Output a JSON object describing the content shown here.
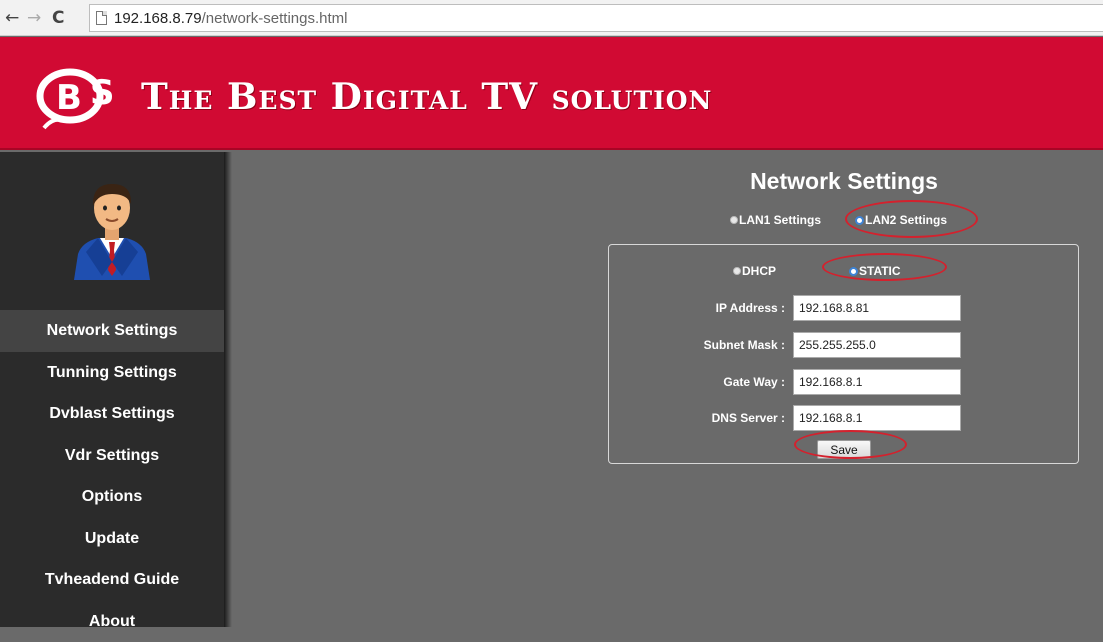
{
  "browser": {
    "back_icon": "back-arrow-icon",
    "forward_icon": "forward-arrow-icon",
    "reload_icon": "reload-icon",
    "url_host": "192.168.8.79",
    "url_path": "/network-settings.html"
  },
  "banner": {
    "title": "The Best Digital TV solution",
    "brand_color": "#d10a33"
  },
  "sidebar": {
    "items": [
      {
        "label": "Network Settings",
        "active": true
      },
      {
        "label": "Tunning Settings"
      },
      {
        "label": "Dvblast Settings"
      },
      {
        "label": "Vdr Settings"
      },
      {
        "label": "Options"
      },
      {
        "label": "Update"
      },
      {
        "label": "Tvheadend Guide"
      },
      {
        "label": "About"
      }
    ]
  },
  "main": {
    "title": "Network Settings",
    "lan_options": [
      {
        "label": "LAN1 Settings",
        "checked": false
      },
      {
        "label": "LAN2 Settings",
        "checked": true
      }
    ],
    "mode_options": [
      {
        "label": "DHCP",
        "checked": false
      },
      {
        "label": "STATIC",
        "checked": true
      }
    ],
    "fields": {
      "ip": {
        "label": "IP Address :",
        "value": "192.168.8.81"
      },
      "subnet": {
        "label": "Subnet Mask :",
        "value": "255.255.255.0"
      },
      "gateway": {
        "label": "Gate Way :",
        "value": "192.168.8.1"
      },
      "dns": {
        "label": "DNS Server :",
        "value": "192.168.8.1"
      }
    },
    "save_label": "Save"
  },
  "colors": {
    "annotation": "#d4212d",
    "radio_checked": "#3d83d5"
  }
}
